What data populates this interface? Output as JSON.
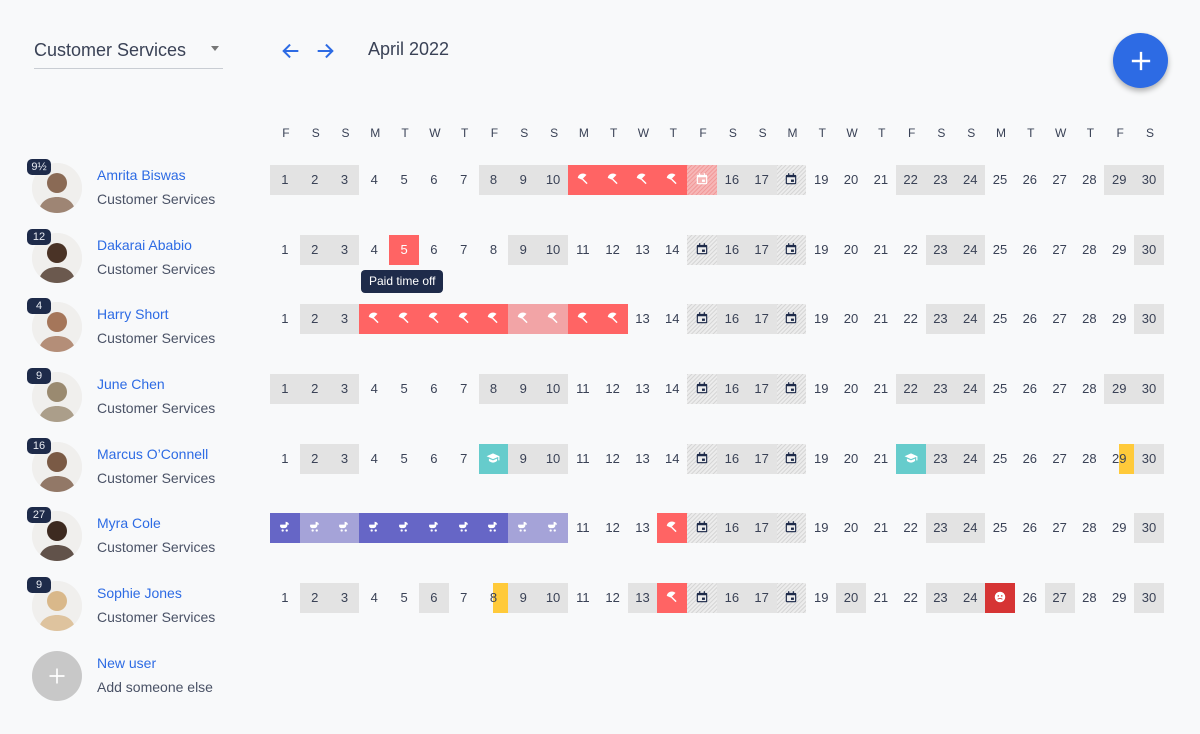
{
  "header": {
    "team_select": "Customer Services",
    "month": "April 2022",
    "prev_icon": "arrow-left-icon",
    "next_icon": "arrow-right-icon",
    "add_icon": "plus-icon"
  },
  "colors": {
    "accent": "#2d6be4",
    "pto": "#ff6464",
    "pto_weekend": "#f2a4a6",
    "maternity": "#6666c6",
    "maternity_weekend": "#a5a3d8",
    "training": "#66cccc",
    "sick": "#d63434",
    "half_day": "#ffca3a",
    "weekend": "#e3e3e3",
    "badge": "#1e2b4a"
  },
  "days_of_week": [
    "F",
    "S",
    "S",
    "M",
    "T",
    "W",
    "T",
    "F",
    "S",
    "S",
    "M",
    "T",
    "W",
    "T",
    "F",
    "S",
    "S",
    "M",
    "T",
    "W",
    "T",
    "F",
    "S",
    "S",
    "M",
    "T",
    "W",
    "T",
    "F",
    "S"
  ],
  "tooltip": "Paid time off",
  "people": [
    {
      "name": "Amrita Biswas",
      "team": "Customer Services",
      "badge": "9½",
      "avatar_color": "#8a6a55",
      "days": {
        "1": "wk",
        "2": "wk",
        "3": "wk",
        "8": "wk",
        "9": "wk",
        "10": "wk",
        "11": "pto",
        "12": "pto",
        "13": "pto",
        "14": "pto",
        "15": "hol-pto",
        "16": "wk",
        "17": "wk",
        "18": "hol",
        "22": "wk",
        "23": "wk",
        "24": "wk",
        "29": "wk",
        "30": "wk"
      }
    },
    {
      "name": "Dakarai Ababio",
      "team": "Customer Services",
      "badge": "12",
      "avatar_color": "#4a3326",
      "days": {
        "2": "wk",
        "3": "wk",
        "5": "pto-num",
        "9": "wk",
        "10": "wk",
        "15": "hol",
        "16": "wk",
        "17": "wk",
        "18": "hol",
        "23": "wk",
        "24": "wk",
        "30": "wk"
      }
    },
    {
      "name": "Harry Short",
      "team": "Customer Services",
      "badge": "4",
      "avatar_color": "#a5765a",
      "days": {
        "2": "wk",
        "3": "wk",
        "4": "pto",
        "5": "pto",
        "6": "pto",
        "7": "pto",
        "8": "pto",
        "9": "pto-light",
        "10": "pto-light",
        "11": "pto",
        "12": "pto",
        "15": "hol",
        "16": "wk",
        "17": "wk",
        "18": "hol",
        "23": "wk",
        "24": "wk",
        "30": "wk"
      }
    },
    {
      "name": "June Chen",
      "team": "Customer Services",
      "badge": "9",
      "avatar_color": "#9a8a70",
      "days": {
        "1": "wk",
        "2": "wk",
        "3": "wk",
        "8": "wk",
        "9": "wk",
        "10": "wk",
        "15": "hol",
        "16": "wk",
        "17": "wk",
        "18": "hol",
        "22": "wk",
        "23": "wk",
        "24": "wk",
        "29": "wk",
        "30": "wk"
      }
    },
    {
      "name": "Marcus O’Connell",
      "team": "Customer Services",
      "badge": "16",
      "avatar_color": "#7a5a45",
      "days": {
        "2": "wk",
        "3": "wk",
        "8": "train",
        "9": "wk",
        "10": "wk",
        "15": "hol",
        "16": "wk",
        "17": "wk",
        "18": "hol",
        "22": "train",
        "23": "wk",
        "24": "wk",
        "29": "half-r",
        "30": "wk"
      }
    },
    {
      "name": "Myra Cole",
      "team": "Customer Services",
      "badge": "27",
      "avatar_color": "#3d2a20",
      "days": {
        "1": "mat",
        "2": "mat-light",
        "3": "mat-light",
        "4": "mat",
        "5": "mat",
        "6": "mat",
        "7": "mat",
        "8": "mat",
        "9": "mat-light",
        "10": "mat-light",
        "14": "pto",
        "15": "hol",
        "16": "wk",
        "17": "wk",
        "18": "hol",
        "23": "wk",
        "24": "wk",
        "30": "wk"
      }
    },
    {
      "name": "Sophie Jones",
      "team": "Customer Services",
      "badge": "9",
      "avatar_color": "#d9b88a",
      "days": {
        "2": "wk",
        "3": "wk",
        "6": "wk",
        "8": "half-r",
        "9": "wk",
        "10": "wk",
        "13": "wk",
        "14": "pto",
        "15": "hol",
        "16": "wk",
        "17": "wk",
        "18": "hol",
        "20": "wk",
        "23": "wk",
        "24": "wk",
        "25": "sick",
        "27": "wk",
        "30": "wk"
      }
    }
  ],
  "new_user": {
    "name": "New user",
    "subtitle": "Add someone else"
  }
}
